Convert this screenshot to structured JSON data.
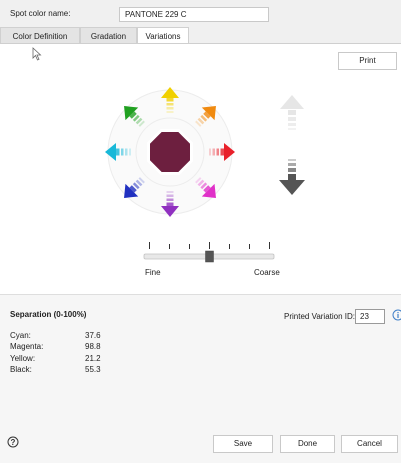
{
  "header": {
    "spot_color_label": "Spot color name:",
    "spot_color_value": "PANTONE 229 C"
  },
  "tabs": [
    {
      "label": "Color Definition",
      "active": false
    },
    {
      "label": "Gradation",
      "active": false
    },
    {
      "label": "Variations",
      "active": true
    }
  ],
  "print_button": "Print",
  "variations": {
    "center_color": "#6d1f3f",
    "arrow_colors": {
      "up": "#f0d000",
      "up_right": "#f08a10",
      "right": "#e8202a",
      "down_right": "#e030c8",
      "down": "#9030c0",
      "down_left": "#2030c0",
      "left": "#18b8d8",
      "up_left": "#20a020"
    },
    "lighter_color": "#e6e6e6",
    "darker_color": "#555555"
  },
  "slider": {
    "fine_label": "Fine",
    "coarse_label": "Coarse",
    "position": 0.5
  },
  "separation": {
    "title": "Separation (0-100%)",
    "inks": [
      {
        "name": "Cyan:",
        "value": "37.6"
      },
      {
        "name": "Magenta:",
        "value": "98.8"
      },
      {
        "name": "Yellow:",
        "value": "21.2"
      },
      {
        "name": "Black:",
        "value": "55.3"
      }
    ]
  },
  "printed_variation": {
    "label": "Printed Variation ID:",
    "value": "23"
  },
  "footer": {
    "save": "Save",
    "done": "Done",
    "cancel": "Cancel"
  }
}
